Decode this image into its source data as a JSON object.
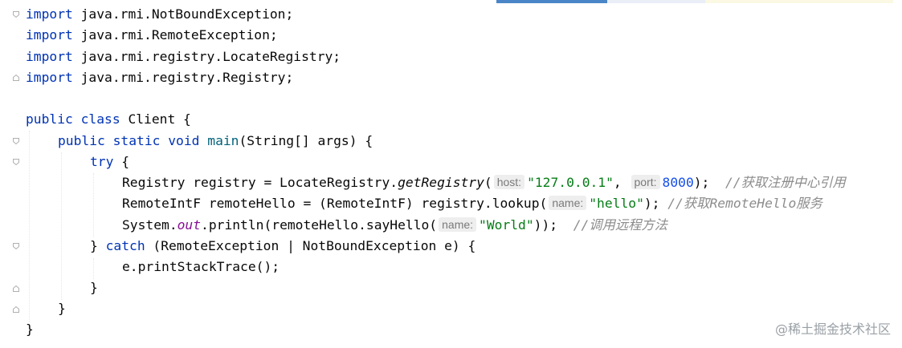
{
  "editor": {
    "language": "java",
    "colors": {
      "keyword": "#0033b3",
      "method_decl": "#00627a",
      "string": "#067d17",
      "number": "#1750eb",
      "static_field": "#871094",
      "comment": "#8c8c8c",
      "text": "#080808",
      "hint_bg": "#eeeeee"
    },
    "code": {
      "l1": {
        "kw": "import",
        "rest": " java.rmi.NotBoundException;"
      },
      "l2": {
        "kw": "import",
        "rest": " java.rmi.RemoteException;"
      },
      "l3": {
        "kw": "import",
        "rest": " java.rmi.registry.LocateRegistry;"
      },
      "l4": {
        "kw": "import",
        "rest": " java.rmi.registry.Registry;"
      },
      "l6": {
        "kw": "public class",
        "rest": " Client {"
      },
      "l7": {
        "kw": "public static void",
        "sp": " ",
        "fn": "main",
        "rest": "(String[] args) {"
      },
      "l8": {
        "kw": "try",
        "rest": " {"
      },
      "l9": {
        "a": "Registry registry = LocateRegistry.",
        "method": "getRegistry",
        "b": "(",
        "hint1": "host:",
        "str": "\"127.0.0.1\"",
        "c": ", ",
        "hint2": "port:",
        "num": "8000",
        "d": ");  ",
        "comment": "//获取注册中心引用"
      },
      "l10": {
        "a": "RemoteIntF remoteHello = (RemoteIntF) registry.lookup(",
        "hint": "name:",
        "str": "\"hello\"",
        "b": "); ",
        "comment": "//获取RemoteHello服务"
      },
      "l11": {
        "a": "System.",
        "field": "out",
        "b": ".println(remoteHello.sayHello(",
        "hint": "name:",
        "str": "\"World\"",
        "c": "));  ",
        "comment": "//调用远程方法"
      },
      "l12": {
        "a": "} ",
        "kw": "catch",
        "b": " (RemoteException | NotBoundException e) {"
      },
      "l13": {
        "text": "e.printStackTrace();"
      },
      "l14": {
        "text": "}"
      },
      "l15": {
        "text": "}"
      },
      "l16": {
        "text": "}"
      }
    }
  },
  "watermark": "@稀土掘金技术社区"
}
